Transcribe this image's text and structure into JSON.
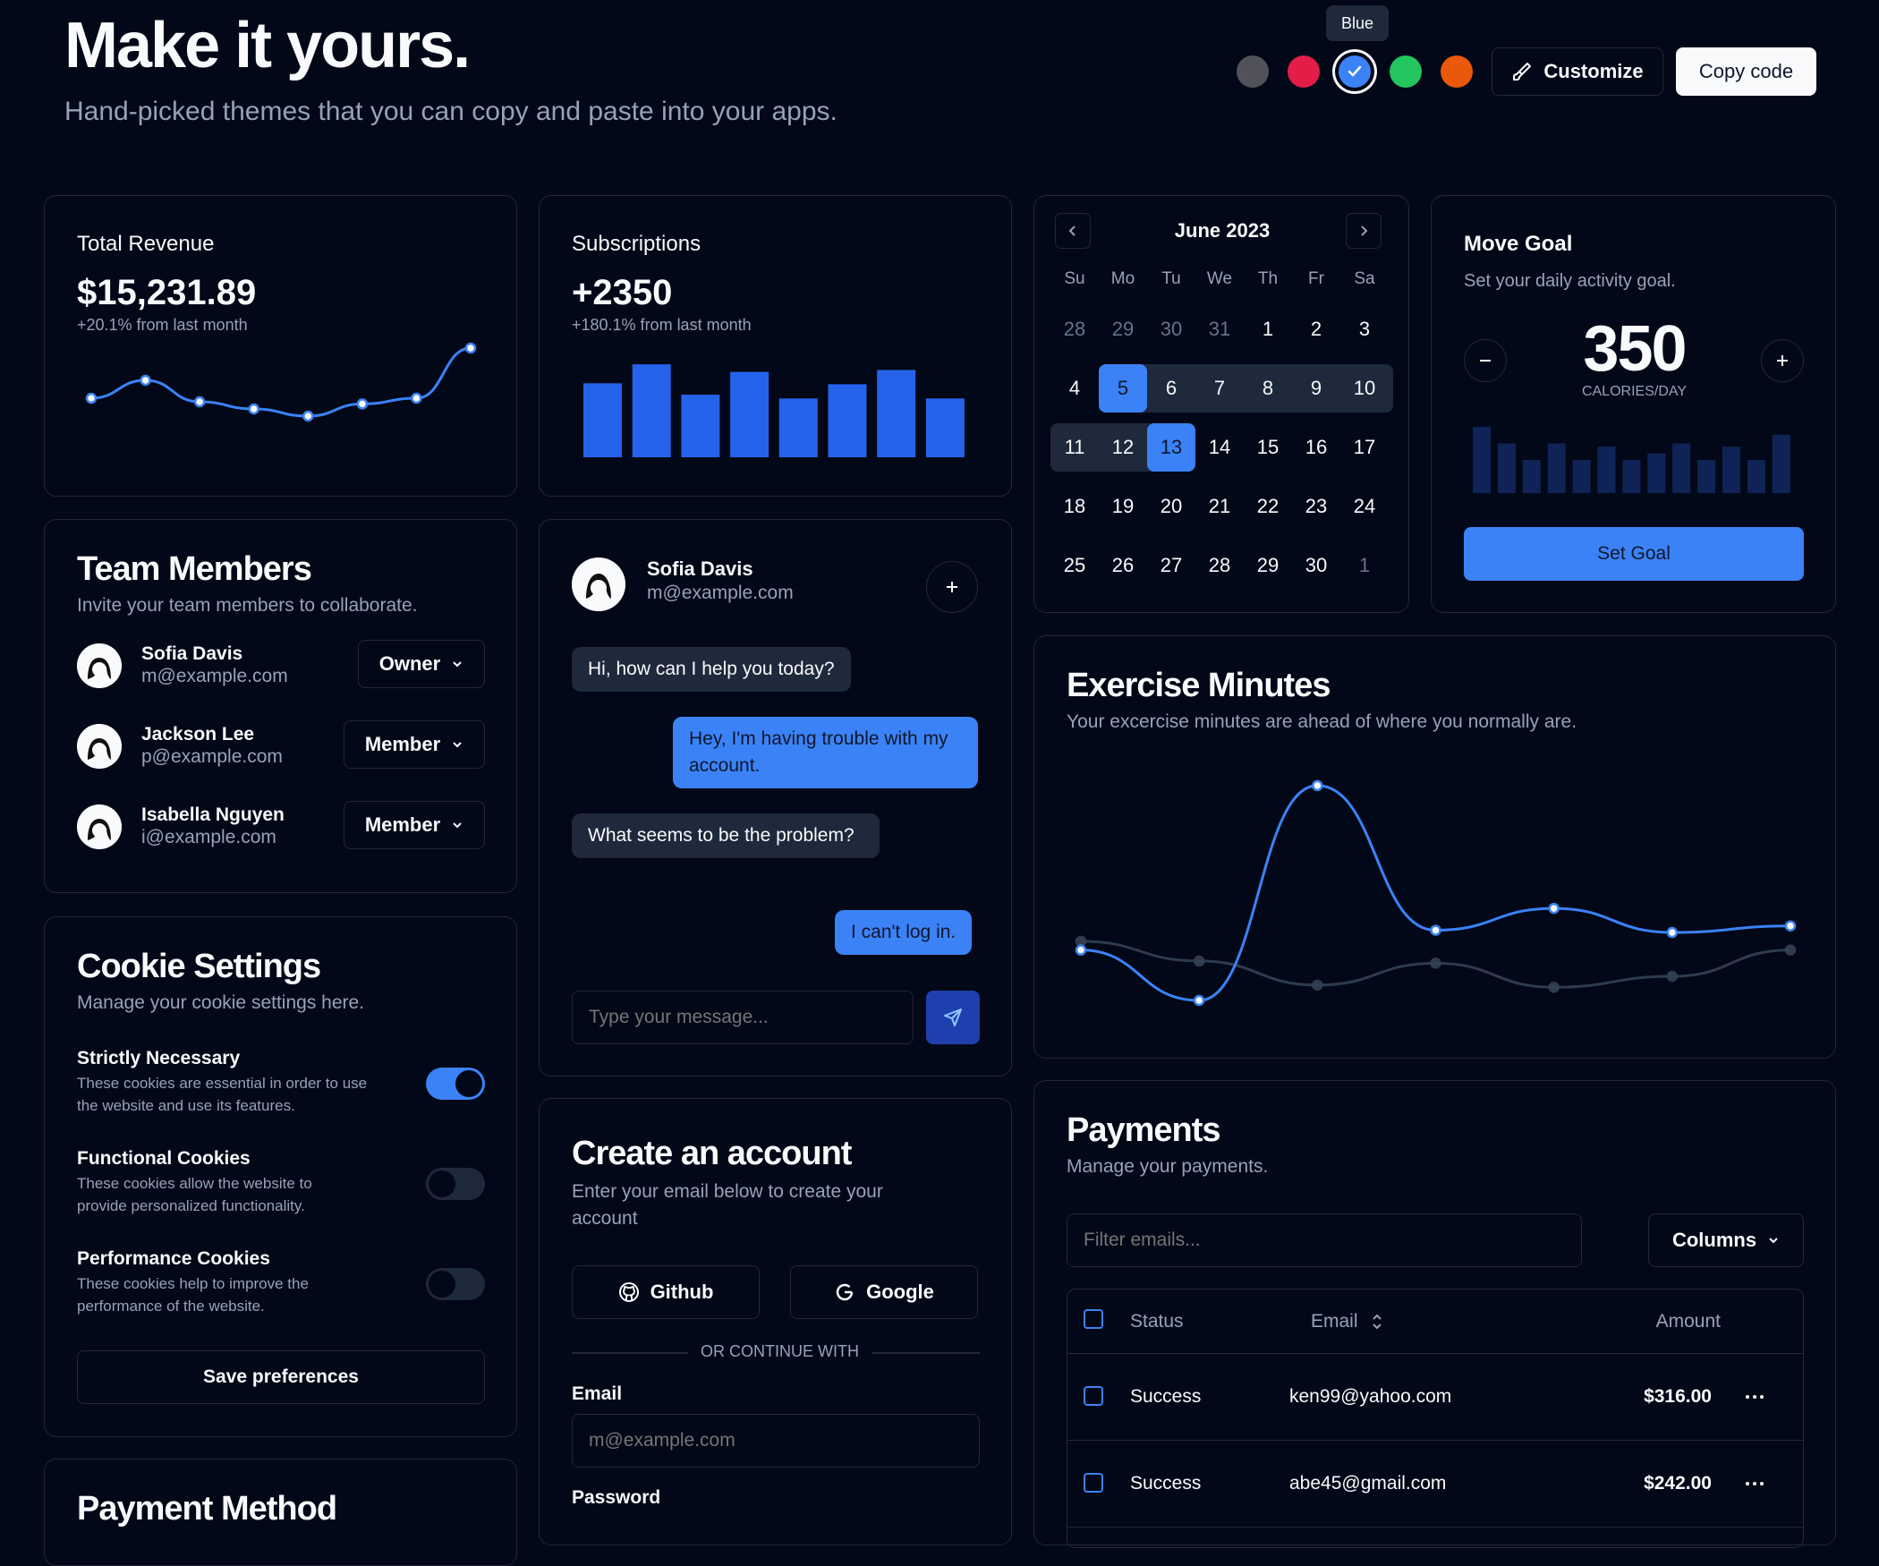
{
  "header": {
    "title": "Make it yours.",
    "subtitle": "Hand-picked themes that you can copy and paste into your apps.",
    "tooltip": "Blue",
    "swatches": [
      "#52525b",
      "#e11d48",
      "#3b82f6",
      "#22c55e",
      "#ea580c"
    ],
    "selected_swatch": 2,
    "customize_label": "Customize",
    "copy_label": "Copy code"
  },
  "revenue": {
    "title": "Total Revenue",
    "value": "$15,231.89",
    "change": "+20.1% from last month",
    "points": [
      0.3,
      0.55,
      0.25,
      0.15,
      0.05,
      0.22,
      0.3,
      1.0
    ]
  },
  "subscriptions": {
    "title": "Subscriptions",
    "value": "+2350",
    "change": "+180.1% from last month",
    "bars": [
      0.78,
      0.98,
      0.66,
      0.9,
      0.62,
      0.77,
      0.92,
      0.62
    ]
  },
  "calendar": {
    "month": "June 2023",
    "weekdays": [
      "Su",
      "Mo",
      "Tu",
      "We",
      "Th",
      "Fr",
      "Sa"
    ],
    "weeks": [
      [
        "28",
        "29",
        "30",
        "31",
        "1",
        "2",
        "3"
      ],
      [
        "4",
        "5",
        "6",
        "7",
        "8",
        "9",
        "10"
      ],
      [
        "11",
        "12",
        "13",
        "14",
        "15",
        "16",
        "17"
      ],
      [
        "18",
        "19",
        "20",
        "21",
        "22",
        "23",
        "24"
      ],
      [
        "25",
        "26",
        "27",
        "28",
        "29",
        "30",
        "1"
      ]
    ]
  },
  "move_goal": {
    "title": "Move Goal",
    "subtitle": "Set your daily activity goal.",
    "value": "350",
    "unit": "CALORIES/DAY",
    "button": "Set Goal",
    "bars": [
      1.0,
      0.75,
      0.5,
      0.75,
      0.5,
      0.7,
      0.5,
      0.6,
      0.75,
      0.5,
      0.7,
      0.5,
      0.88
    ]
  },
  "team": {
    "title": "Team Members",
    "subtitle": "Invite your team members to collaborate.",
    "members": [
      {
        "name": "Sofia Davis",
        "email": "m@example.com",
        "role": "Owner"
      },
      {
        "name": "Jackson Lee",
        "email": "p@example.com",
        "role": "Member"
      },
      {
        "name": "Isabella Nguyen",
        "email": "i@example.com",
        "role": "Member"
      }
    ]
  },
  "chat": {
    "name": "Sofia Davis",
    "email": "m@example.com",
    "messages": [
      {
        "from": "them",
        "text": "Hi, how can I help you today?"
      },
      {
        "from": "me",
        "text": "Hey, I'm having trouble with my account."
      },
      {
        "from": "them",
        "text": "What seems to be the problem?"
      },
      {
        "from": "me",
        "text": "I can't log in."
      }
    ],
    "placeholder": "Type your message..."
  },
  "exercise": {
    "title": "Exercise Minutes",
    "subtitle": "Your excercise minutes are ahead of where you normally are.",
    "series_a": [
      0.23,
      0.0,
      0.98,
      0.32,
      0.42,
      0.31,
      0.34
    ],
    "series_b": [
      0.27,
      0.18,
      0.07,
      0.17,
      0.06,
      0.11,
      0.23
    ]
  },
  "cookies": {
    "title": "Cookie Settings",
    "subtitle": "Manage your cookie settings here.",
    "items": [
      {
        "title": "Strictly Necessary",
        "desc1": "These cookies are essential in order to use",
        "desc2": "the website and use its features.",
        "on": true
      },
      {
        "title": "Functional Cookies",
        "desc1": "These cookies allow the website to",
        "desc2": "provide personalized functionality.",
        "on": false
      },
      {
        "title": "Performance Cookies",
        "desc1": "These cookies help to improve the",
        "desc2": "performance of the website.",
        "on": false
      }
    ],
    "save_label": "Save preferences"
  },
  "account": {
    "title": "Create an account",
    "subtitle_1": "Enter your email below to create your",
    "subtitle_2": "account",
    "github_label": "Github",
    "google_label": "Google",
    "divider": "OR CONTINUE WITH",
    "email_label": "Email",
    "email_placeholder": "m@example.com",
    "password_label": "Password"
  },
  "payments": {
    "title": "Payments",
    "subtitle": "Manage your payments.",
    "filter_placeholder": "Filter emails...",
    "columns_label": "Columns",
    "headers": {
      "status": "Status",
      "email": "Email",
      "amount": "Amount"
    },
    "rows": [
      {
        "status": "Success",
        "email": "ken99@yahoo.com",
        "amount": "$316.00"
      },
      {
        "status": "Success",
        "email": "abe45@gmail.com",
        "amount": "$242.00"
      }
    ]
  },
  "payment_method": {
    "title": "Payment Method"
  }
}
